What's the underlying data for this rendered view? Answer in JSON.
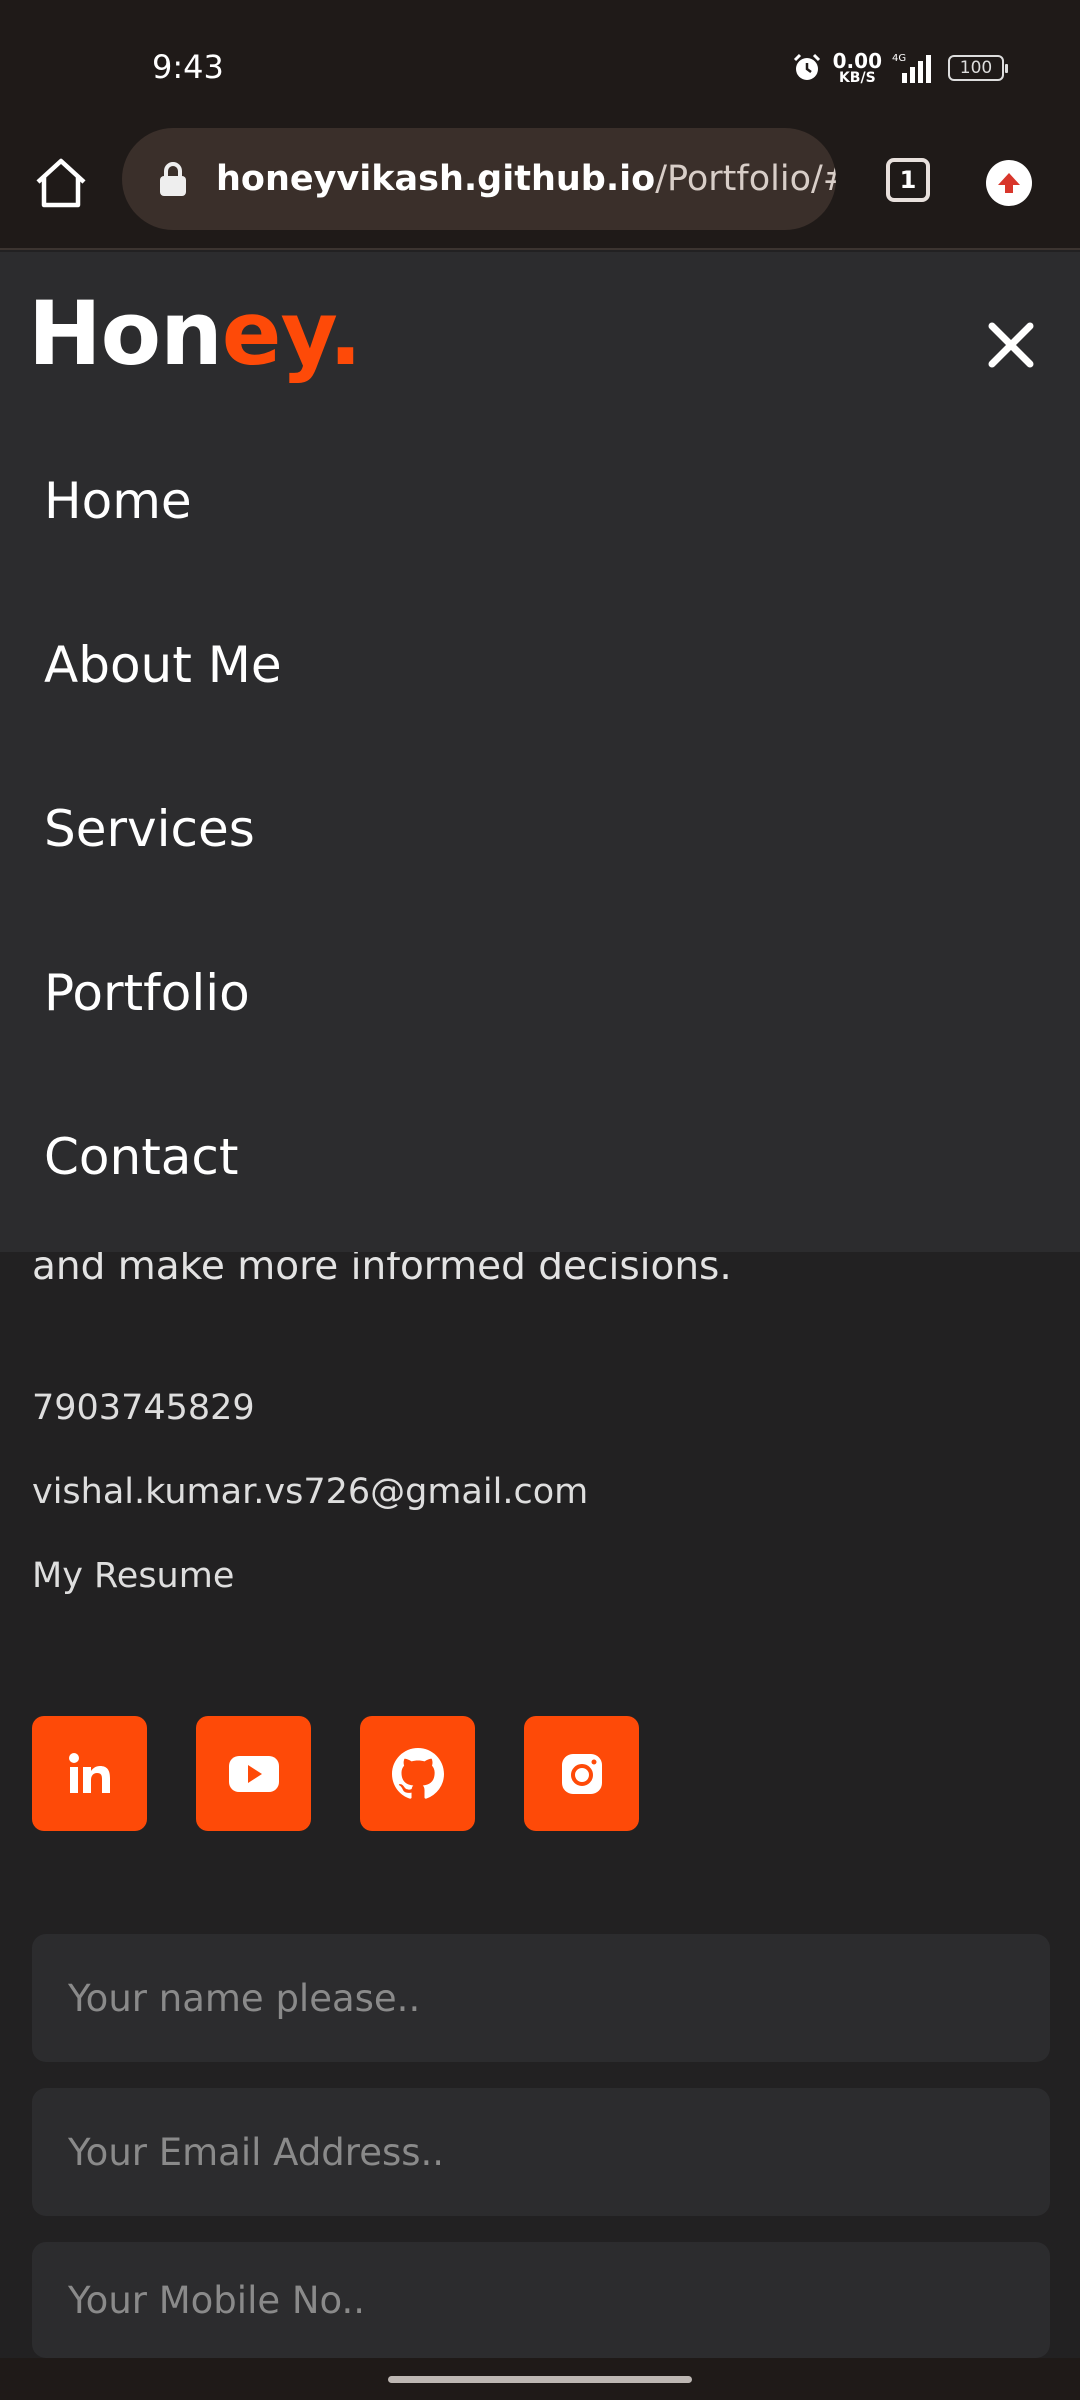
{
  "status_bar": {
    "time": "9:43",
    "net_speed_value": "0.00",
    "net_speed_unit": "KB/S",
    "network": "4G",
    "battery": "100"
  },
  "browser": {
    "url_host": "honeyvikash.github.io",
    "url_path": "/Portfolio/#cont",
    "tab_count": "1"
  },
  "logo": {
    "part1": "Hon",
    "part2": "ey",
    "part3": "."
  },
  "nav": {
    "items": [
      {
        "label": "Home"
      },
      {
        "label": "About Me"
      },
      {
        "label": "Services"
      },
      {
        "label": "Portfolio"
      },
      {
        "label": "Contact"
      }
    ]
  },
  "contact": {
    "about_tail": "and make more informed decisions.",
    "phone": "7903745829",
    "email": "vishal.kumar.vs726@gmail.com",
    "resume_link": "My Resume",
    "social": [
      {
        "icon": "linkedin-icon"
      },
      {
        "icon": "youtube-icon"
      },
      {
        "icon": "github-icon"
      },
      {
        "icon": "instagram-icon"
      }
    ],
    "form": {
      "name_placeholder": "Your name please..",
      "email_placeholder": "Your Email Address..",
      "mobile_placeholder": "Your Mobile No.."
    }
  },
  "colors": {
    "accent": "#fe4a08",
    "background": "#222122",
    "nav_overlay": "#2c2c2e",
    "browser_chrome": "#1f1a18"
  }
}
